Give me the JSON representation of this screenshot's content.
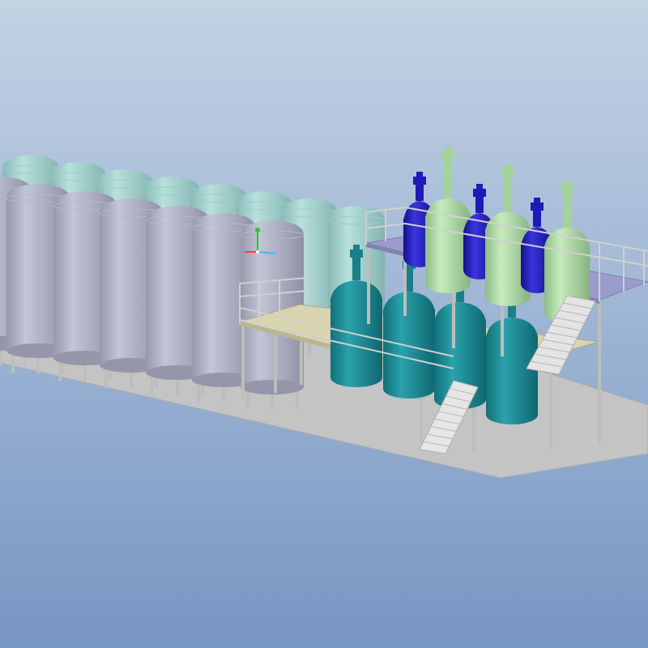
{
  "viewport": {
    "background_top": "#c3d3e4",
    "background_bottom": "#7795c3"
  },
  "colors": {
    "floor": "#c4c4c4",
    "floor_edge": "#a9a9a9",
    "storage_tank_body": "#a9aabd",
    "storage_tank_dome": "#a1cdca",
    "reactor_teal": "#1c8c96",
    "reactor_blue": "#1e1ab8",
    "reactor_green": "#a8d7a0",
    "platform_lower": "#d8d5ae",
    "platform_upper": "#9a9ccb",
    "railing": "#c6c6c6",
    "stairs": "#e4e4e4",
    "legs": "#bdbdbd"
  },
  "scene": {
    "storage_tanks": {
      "rows": 2,
      "front_row_count": 6,
      "back_row_count": 8
    },
    "lower_platform": {
      "reactor_count": 4,
      "reactor_color": "teal"
    },
    "upper_platform": {
      "reactor_count": 6,
      "reactor_colors": [
        "blue",
        "green"
      ]
    },
    "stairs_count": 2
  },
  "axis_triad": {
    "x_color": "#ff3b3b",
    "y_color": "#22cc33",
    "z_color": "#33bbff"
  }
}
